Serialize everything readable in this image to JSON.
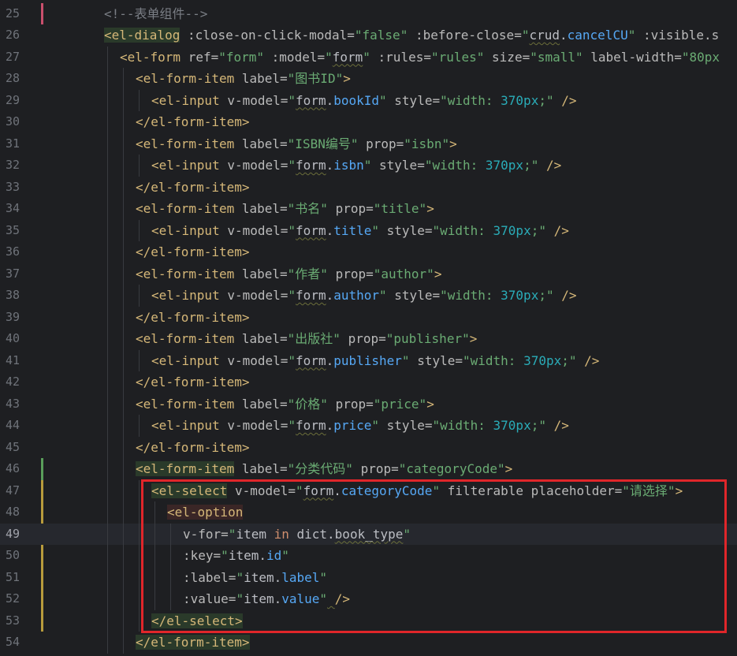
{
  "editor": {
    "lines": [
      {
        "num": "25",
        "indent": 0,
        "tokens": [
          {
            "t": "<!--表单组件-->",
            "c": "t-cmt"
          }
        ]
      },
      {
        "num": "26",
        "indent": 0,
        "bg": "green",
        "tokens": [
          {
            "t": "<el-dialog",
            "c": "t-tag",
            "bg": true
          },
          {
            "t": " :close-on-click-modal=",
            "c": "t-attr"
          },
          {
            "t": "\"false\"",
            "c": "t-str"
          },
          {
            "t": " :before-close=",
            "c": "t-attr"
          },
          {
            "t": "\"",
            "c": "t-str"
          },
          {
            "t": "crud",
            "c": "t-plain",
            "sq": true
          },
          {
            "t": ".",
            "c": "t-plain"
          },
          {
            "t": "cancelCU",
            "c": "t-ident"
          },
          {
            "t": "\"",
            "c": "t-str"
          },
          {
            "t": " :visible.s",
            "c": "t-attr"
          }
        ]
      },
      {
        "num": "27",
        "indent": 1,
        "tokens": [
          {
            "t": "<el-form",
            "c": "t-tag"
          },
          {
            "t": " ref=",
            "c": "t-attr"
          },
          {
            "t": "\"form\"",
            "c": "t-str"
          },
          {
            "t": " :model=",
            "c": "t-attr"
          },
          {
            "t": "\"",
            "c": "t-str"
          },
          {
            "t": "form",
            "c": "t-plain",
            "sq": true
          },
          {
            "t": "\"",
            "c": "t-str"
          },
          {
            "t": " :rules=",
            "c": "t-attr"
          },
          {
            "t": "\"rules\"",
            "c": "t-str"
          },
          {
            "t": " size=",
            "c": "t-attr"
          },
          {
            "t": "\"small\"",
            "c": "t-str"
          },
          {
            "t": " label-width=",
            "c": "t-attr"
          },
          {
            "t": "\"80px",
            "c": "t-str"
          }
        ]
      },
      {
        "num": "28",
        "indent": 2,
        "tokens": [
          {
            "t": "<el-form-item",
            "c": "t-tag"
          },
          {
            "t": " label=",
            "c": "t-attr"
          },
          {
            "t": "\"图书ID\"",
            "c": "t-str"
          },
          {
            "t": ">",
            "c": "t-tag"
          }
        ]
      },
      {
        "num": "29",
        "indent": 3,
        "tokens": [
          {
            "t": "<el-input",
            "c": "t-tag"
          },
          {
            "t": " v-model=",
            "c": "t-attr"
          },
          {
            "t": "\"",
            "c": "t-str"
          },
          {
            "t": "form",
            "c": "t-plain",
            "sq": true
          },
          {
            "t": ".",
            "c": "t-plain"
          },
          {
            "t": "bookId",
            "c": "t-ident"
          },
          {
            "t": "\"",
            "c": "t-str"
          },
          {
            "t": " style=",
            "c": "t-attr"
          },
          {
            "t": "\"width: ",
            "c": "t-str"
          },
          {
            "t": "370px",
            "c": "t-num"
          },
          {
            "t": ";\"",
            "c": "t-str"
          },
          {
            "t": " />",
            "c": "t-tag"
          }
        ]
      },
      {
        "num": "30",
        "indent": 2,
        "tokens": [
          {
            "t": "</el-form-item>",
            "c": "t-tag"
          }
        ]
      },
      {
        "num": "31",
        "indent": 2,
        "tokens": [
          {
            "t": "<el-form-item",
            "c": "t-tag"
          },
          {
            "t": " label=",
            "c": "t-attr"
          },
          {
            "t": "\"ISBN编号\"",
            "c": "t-str"
          },
          {
            "t": " prop=",
            "c": "t-attr"
          },
          {
            "t": "\"isbn\"",
            "c": "t-str"
          },
          {
            "t": ">",
            "c": "t-tag"
          }
        ]
      },
      {
        "num": "32",
        "indent": 3,
        "tokens": [
          {
            "t": "<el-input",
            "c": "t-tag"
          },
          {
            "t": " v-model=",
            "c": "t-attr"
          },
          {
            "t": "\"",
            "c": "t-str"
          },
          {
            "t": "form",
            "c": "t-plain",
            "sq": true
          },
          {
            "t": ".",
            "c": "t-plain"
          },
          {
            "t": "isbn",
            "c": "t-ident"
          },
          {
            "t": "\"",
            "c": "t-str"
          },
          {
            "t": " style=",
            "c": "t-attr"
          },
          {
            "t": "\"width: ",
            "c": "t-str"
          },
          {
            "t": "370px",
            "c": "t-num"
          },
          {
            "t": ";\"",
            "c": "t-str"
          },
          {
            "t": " />",
            "c": "t-tag"
          }
        ]
      },
      {
        "num": "33",
        "indent": 2,
        "tokens": [
          {
            "t": "</el-form-item>",
            "c": "t-tag"
          }
        ]
      },
      {
        "num": "34",
        "indent": 2,
        "tokens": [
          {
            "t": "<el-form-item",
            "c": "t-tag"
          },
          {
            "t": " label=",
            "c": "t-attr"
          },
          {
            "t": "\"书名\"",
            "c": "t-str"
          },
          {
            "t": " prop=",
            "c": "t-attr"
          },
          {
            "t": "\"title\"",
            "c": "t-str"
          },
          {
            "t": ">",
            "c": "t-tag"
          }
        ]
      },
      {
        "num": "35",
        "indent": 3,
        "tokens": [
          {
            "t": "<el-input",
            "c": "t-tag"
          },
          {
            "t": " v-model=",
            "c": "t-attr"
          },
          {
            "t": "\"",
            "c": "t-str"
          },
          {
            "t": "form",
            "c": "t-plain",
            "sq": true
          },
          {
            "t": ".",
            "c": "t-plain"
          },
          {
            "t": "title",
            "c": "t-ident"
          },
          {
            "t": "\"",
            "c": "t-str"
          },
          {
            "t": " style=",
            "c": "t-attr"
          },
          {
            "t": "\"width: ",
            "c": "t-str"
          },
          {
            "t": "370px",
            "c": "t-num"
          },
          {
            "t": ";\"",
            "c": "t-str"
          },
          {
            "t": " />",
            "c": "t-tag"
          }
        ]
      },
      {
        "num": "36",
        "indent": 2,
        "tokens": [
          {
            "t": "</el-form-item>",
            "c": "t-tag"
          }
        ]
      },
      {
        "num": "37",
        "indent": 2,
        "tokens": [
          {
            "t": "<el-form-item",
            "c": "t-tag"
          },
          {
            "t": " label=",
            "c": "t-attr"
          },
          {
            "t": "\"作者\"",
            "c": "t-str"
          },
          {
            "t": " prop=",
            "c": "t-attr"
          },
          {
            "t": "\"author\"",
            "c": "t-str"
          },
          {
            "t": ">",
            "c": "t-tag"
          }
        ]
      },
      {
        "num": "38",
        "indent": 3,
        "tokens": [
          {
            "t": "<el-input",
            "c": "t-tag"
          },
          {
            "t": " v-model=",
            "c": "t-attr"
          },
          {
            "t": "\"",
            "c": "t-str"
          },
          {
            "t": "form",
            "c": "t-plain",
            "sq": true
          },
          {
            "t": ".",
            "c": "t-plain"
          },
          {
            "t": "author",
            "c": "t-ident"
          },
          {
            "t": "\"",
            "c": "t-str"
          },
          {
            "t": " style=",
            "c": "t-attr"
          },
          {
            "t": "\"width: ",
            "c": "t-str"
          },
          {
            "t": "370px",
            "c": "t-num"
          },
          {
            "t": ";\"",
            "c": "t-str"
          },
          {
            "t": " />",
            "c": "t-tag"
          }
        ]
      },
      {
        "num": "39",
        "indent": 2,
        "tokens": [
          {
            "t": "</el-form-item>",
            "c": "t-tag"
          }
        ]
      },
      {
        "num": "40",
        "indent": 2,
        "tokens": [
          {
            "t": "<el-form-item",
            "c": "t-tag"
          },
          {
            "t": " label=",
            "c": "t-attr"
          },
          {
            "t": "\"出版社\"",
            "c": "t-str"
          },
          {
            "t": " prop=",
            "c": "t-attr"
          },
          {
            "t": "\"publisher\"",
            "c": "t-str"
          },
          {
            "t": ">",
            "c": "t-tag"
          }
        ]
      },
      {
        "num": "41",
        "indent": 3,
        "tokens": [
          {
            "t": "<el-input",
            "c": "t-tag"
          },
          {
            "t": " v-model=",
            "c": "t-attr"
          },
          {
            "t": "\"",
            "c": "t-str"
          },
          {
            "t": "form",
            "c": "t-plain",
            "sq": true
          },
          {
            "t": ".",
            "c": "t-plain"
          },
          {
            "t": "publisher",
            "c": "t-ident"
          },
          {
            "t": "\"",
            "c": "t-str"
          },
          {
            "t": " style=",
            "c": "t-attr"
          },
          {
            "t": "\"width: ",
            "c": "t-str"
          },
          {
            "t": "370px",
            "c": "t-num"
          },
          {
            "t": ";\"",
            "c": "t-str"
          },
          {
            "t": " />",
            "c": "t-tag"
          }
        ]
      },
      {
        "num": "42",
        "indent": 2,
        "tokens": [
          {
            "t": "</el-form-item>",
            "c": "t-tag"
          }
        ]
      },
      {
        "num": "43",
        "indent": 2,
        "tokens": [
          {
            "t": "<el-form-item",
            "c": "t-tag"
          },
          {
            "t": " label=",
            "c": "t-attr"
          },
          {
            "t": "\"价格\"",
            "c": "t-str"
          },
          {
            "t": " prop=",
            "c": "t-attr"
          },
          {
            "t": "\"price\"",
            "c": "t-str"
          },
          {
            "t": ">",
            "c": "t-tag"
          }
        ]
      },
      {
        "num": "44",
        "indent": 3,
        "tokens": [
          {
            "t": "<el-input",
            "c": "t-tag"
          },
          {
            "t": " v-model=",
            "c": "t-attr"
          },
          {
            "t": "\"",
            "c": "t-str"
          },
          {
            "t": "form",
            "c": "t-plain",
            "sq": true
          },
          {
            "t": ".",
            "c": "t-plain"
          },
          {
            "t": "price",
            "c": "t-ident"
          },
          {
            "t": "\"",
            "c": "t-str"
          },
          {
            "t": " style=",
            "c": "t-attr"
          },
          {
            "t": "\"width: ",
            "c": "t-str"
          },
          {
            "t": "370px",
            "c": "t-num"
          },
          {
            "t": ";\"",
            "c": "t-str"
          },
          {
            "t": " />",
            "c": "t-tag"
          }
        ]
      },
      {
        "num": "45",
        "indent": 2,
        "tokens": [
          {
            "t": "</el-form-item>",
            "c": "t-tag"
          }
        ]
      },
      {
        "num": "46",
        "indent": 2,
        "tokens": [
          {
            "t": "<el-form-item",
            "c": "t-tag",
            "bg": true
          },
          {
            "t": " label=",
            "c": "t-attr"
          },
          {
            "t": "\"分类代码\"",
            "c": "t-str"
          },
          {
            "t": " prop=",
            "c": "t-attr"
          },
          {
            "t": "\"categoryCode\"",
            "c": "t-str"
          },
          {
            "t": ">",
            "c": "t-tag"
          }
        ]
      },
      {
        "num": "47",
        "indent": 3,
        "tokens": [
          {
            "t": "<el-select",
            "c": "t-tag",
            "bg": true
          },
          {
            "t": " v-model=",
            "c": "t-attr"
          },
          {
            "t": "\"",
            "c": "t-str"
          },
          {
            "t": "form",
            "c": "t-plain",
            "sq": true
          },
          {
            "t": ".",
            "c": "t-plain"
          },
          {
            "t": "categoryCode",
            "c": "t-ident"
          },
          {
            "t": "\"",
            "c": "t-str"
          },
          {
            "t": " filterable",
            "c": "t-attr"
          },
          {
            "t": " placeholder=",
            "c": "t-attr"
          },
          {
            "t": "\"请选择\"",
            "c": "t-str"
          },
          {
            "t": ">",
            "c": "t-tag"
          }
        ]
      },
      {
        "num": "48",
        "indent": 4,
        "tokens": [
          {
            "t": "<el-option",
            "c": "t-tag",
            "bgr": true
          }
        ]
      },
      {
        "num": "49",
        "indent": 5,
        "current": true,
        "tokens": [
          {
            "t": "v-for=",
            "c": "t-attr"
          },
          {
            "t": "\"",
            "c": "t-str"
          },
          {
            "t": "item ",
            "c": "t-plain"
          },
          {
            "t": "in",
            "c": "t-kw"
          },
          {
            "t": " dict.",
            "c": "t-plain"
          },
          {
            "t": "book_type",
            "c": "t-plain",
            "sq": true
          },
          {
            "t": "\"",
            "c": "t-str"
          }
        ]
      },
      {
        "num": "50",
        "indent": 5,
        "tokens": [
          {
            "t": ":key=",
            "c": "t-attr"
          },
          {
            "t": "\"",
            "c": "t-str"
          },
          {
            "t": "item.",
            "c": "t-plain"
          },
          {
            "t": "id",
            "c": "t-ident"
          },
          {
            "t": "\"",
            "c": "t-str"
          }
        ]
      },
      {
        "num": "51",
        "indent": 5,
        "tokens": [
          {
            "t": ":label=",
            "c": "t-attr"
          },
          {
            "t": "\"",
            "c": "t-str"
          },
          {
            "t": "item.",
            "c": "t-plain"
          },
          {
            "t": "label",
            "c": "t-ident"
          },
          {
            "t": "\"",
            "c": "t-str"
          }
        ]
      },
      {
        "num": "52",
        "indent": 5,
        "tokens": [
          {
            "t": ":value=",
            "c": "t-attr"
          },
          {
            "t": "\"",
            "c": "t-str"
          },
          {
            "t": "item.",
            "c": "t-plain"
          },
          {
            "t": "value",
            "c": "t-ident"
          },
          {
            "t": "\"",
            "c": "t-str"
          },
          {
            "t": " ",
            "c": "t-plain",
            "sq": true
          },
          {
            "t": "/>",
            "c": "t-tag"
          }
        ]
      },
      {
        "num": "53",
        "indent": 3,
        "tokens": [
          {
            "t": "</el-select>",
            "c": "t-tag",
            "bg": true
          }
        ]
      },
      {
        "num": "54",
        "indent": 2,
        "tokens": [
          {
            "t": "</el-form-item>",
            "c": "t-tag",
            "bg": true
          }
        ]
      }
    ]
  },
  "annotation": {
    "color": "#e0262a"
  }
}
